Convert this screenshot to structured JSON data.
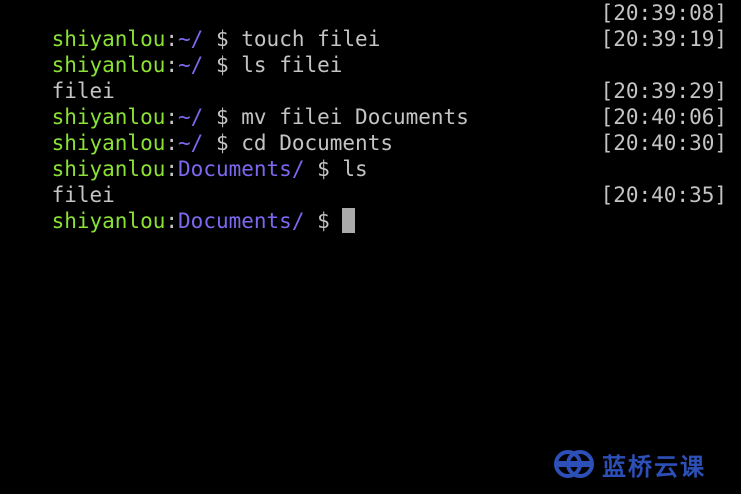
{
  "terminal": {
    "colors": {
      "background": "#000000",
      "user": "#8ae234",
      "path": "#7b68ee",
      "text": "#c4c4c4",
      "cursor": "#aaaaaa"
    },
    "lines": [
      {
        "user": "shiyanlou",
        "sep": ":",
        "path": "~/",
        "dollar": " $ ",
        "cmd": "touch filei",
        "ts": "[20:39:08]"
      },
      {
        "user": "shiyanlou",
        "sep": ":",
        "path": "~/",
        "dollar": " $ ",
        "cmd": "ls filei",
        "ts": "[20:39:19]"
      },
      {
        "output": "filei"
      },
      {
        "user": "shiyanlou",
        "sep": ":",
        "path": "~/",
        "dollar": " $ ",
        "cmd": "mv filei Documents",
        "ts": "[20:39:29]"
      },
      {
        "user": "shiyanlou",
        "sep": ":",
        "path": "~/",
        "dollar": " $ ",
        "cmd": "cd Documents",
        "ts": "[20:40:06]"
      },
      {
        "user": "shiyanlou",
        "sep": ":",
        "path": "Documents/",
        "dollar": " $ ",
        "cmd": "ls",
        "ts": "[20:40:30]"
      },
      {
        "output": "filei"
      },
      {
        "user": "shiyanlou",
        "sep": ":",
        "path": "Documents/",
        "dollar": " $ ",
        "cmd": "",
        "ts": "[20:40:35]"
      }
    ]
  },
  "watermark": {
    "icon": "lanqiao-logo-icon",
    "text": "蓝桥云课",
    "color": "#2c4fb8"
  }
}
